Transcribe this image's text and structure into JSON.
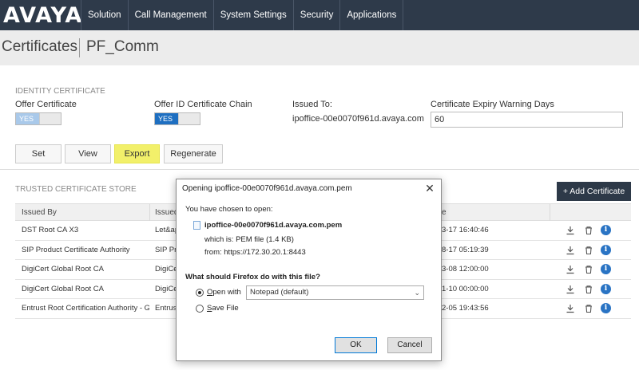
{
  "header": {
    "logo": "AVAYA",
    "nav": [
      "Solution",
      "Call Management",
      "System Settings",
      "Security",
      "Applications"
    ]
  },
  "page": {
    "title": "Certificates",
    "subtitle": "PF_Comm"
  },
  "identity": {
    "section_label": "IDENTITY CERTIFICATE",
    "offer_cert_label": "Offer Certificate",
    "offer_cert_toggle": "YES",
    "offer_chain_label": "Offer ID Certificate Chain",
    "offer_chain_toggle": "YES",
    "issued_to_label": "Issued To:",
    "issued_to_value": "ipoffice-00e0070f961d.avaya.com",
    "expiry_label": "Certificate Expiry Warning Days",
    "expiry_value": "60",
    "buttons": {
      "set": "Set",
      "view": "View",
      "export": "Export",
      "regenerate": "Regenerate"
    }
  },
  "trusted": {
    "section_label": "TRUSTED CERTIFICATE STORE",
    "add_button": "+ Add Certificate",
    "columns": [
      "Issued By",
      "Issued",
      "e"
    ],
    "rows": [
      {
        "issued_by": "DST Root CA X3",
        "issued": "Let&ap",
        "date": "3-17 16:40:46"
      },
      {
        "issued_by": "SIP Product Certificate Authority",
        "issued": "SIP Pro",
        "date": "8-17 05:19:39"
      },
      {
        "issued_by": "DigiCert Global Root CA",
        "issued": "DigiCer",
        "date": "3-08 12:00:00"
      },
      {
        "issued_by": "DigiCert Global Root CA",
        "issued": "DigiCer",
        "date": "1-10 00:00:00"
      },
      {
        "issued_by": "Entrust Root Certification Authority - G2",
        "issued": "Entrust",
        "date": "2-05 19:43:56"
      }
    ]
  },
  "dialog": {
    "title": "Opening ipoffice-00e0070f961d.avaya.com.pem",
    "chosen_text": "You have chosen to open:",
    "filename": "ipoffice-00e0070f961d.avaya.com.pem",
    "which_is": "which is:  PEM file (1.4 KB)",
    "from": "from:  https://172.30.20.1:8443",
    "question": "What should Firefox do with this file?",
    "open_with": "pen with",
    "open_with_key": "O",
    "open_with_app": "Notepad (default)",
    "save_file": "ave File",
    "save_file_key": "S",
    "ok": "OK",
    "cancel": "Cancel"
  },
  "colors": {
    "topbar": "#2e3a4a",
    "toggle_on_1": "#a9c9ea",
    "toggle_on_2": "#1e6fc1",
    "export_highlight": "#f2f06a",
    "info_icon": "#2a74c4"
  }
}
